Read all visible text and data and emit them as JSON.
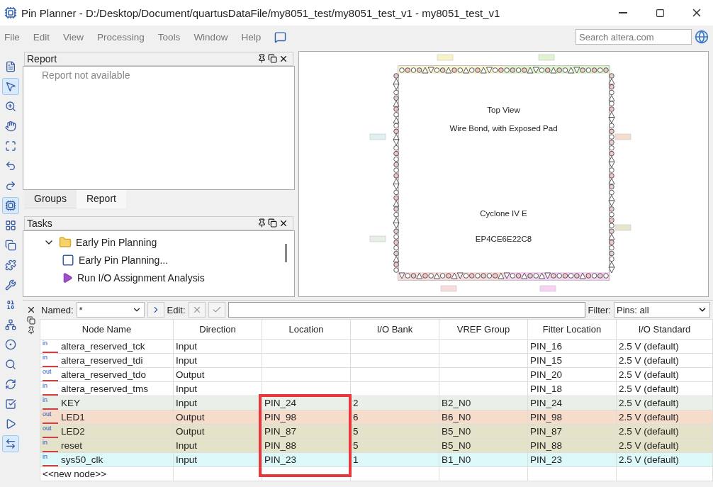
{
  "window": {
    "title": "Pin Planner - D:/Desktop/Document/quartusDataFile/my8051_test/my8051_test_v1 - my8051_test_v1"
  },
  "menu": [
    "File",
    "Edit",
    "View",
    "Processing",
    "Tools",
    "Window",
    "Help"
  ],
  "search": {
    "placeholder": "Search altera.com"
  },
  "toolbar": [
    {
      "kind": "report",
      "selected": false
    },
    {
      "kind": "pointer",
      "selected": true
    },
    {
      "kind": "zoom",
      "selected": false
    },
    {
      "kind": "hand",
      "selected": false
    },
    {
      "kind": "fit",
      "selected": false
    },
    {
      "kind": "undo",
      "selected": false
    },
    {
      "kind": "redo",
      "selected": false
    },
    {
      "kind": "chip",
      "selected": true
    },
    {
      "kind": "vref",
      "selected": false
    },
    {
      "kind": "edge",
      "selected": false
    },
    {
      "kind": "grid",
      "selected": false
    },
    {
      "kind": "probe",
      "selected": false
    },
    {
      "kind": "pins",
      "selected": false
    },
    {
      "kind": "tree",
      "selected": false
    },
    {
      "kind": "dots",
      "selected": false
    },
    {
      "kind": "find",
      "selected": false
    },
    {
      "kind": "refresh",
      "selected": false
    },
    {
      "kind": "check",
      "selected": false
    },
    {
      "kind": "io",
      "selected": false
    },
    {
      "kind": "swap",
      "selected": true
    }
  ],
  "report": {
    "title": "Report",
    "message": "Report not available"
  },
  "panel_tabs": [
    {
      "label": "Groups",
      "selected": false
    },
    {
      "label": "Report",
      "selected": true
    }
  ],
  "tasks": {
    "title": "Tasks",
    "items": [
      {
        "kind": "folder",
        "label": "Early Pin Planning",
        "expanded": true,
        "children": [
          {
            "kind": "window",
            "label": "Early Pin Planning..."
          },
          {
            "kind": "run",
            "label": "Run I/O Assignment Analysis"
          }
        ]
      }
    ]
  },
  "chip_view": {
    "texts": [
      "Top View",
      "Wire Bond, with Exposed Pad",
      "Cyclone IV E",
      "EP4CE6E22C8"
    ]
  },
  "filter_bar": {
    "named_label": "Named:",
    "named_value": "*",
    "edit_label": "Edit:",
    "filter_label": "Filter:",
    "filter_value": "Pins: all"
  },
  "table": {
    "columns": [
      "Node Name",
      "Direction",
      "Location",
      "I/O Bank",
      "VREF Group",
      "Fitter Location",
      "I/O Standard"
    ],
    "rows": [
      {
        "io": "in",
        "cells": [
          "altera_reserved_tck",
          "Input",
          "",
          "",
          "",
          "PIN_16",
          "2.5 V (default)"
        ],
        "marked": false
      },
      {
        "io": "in",
        "cells": [
          "altera_reserved_tdi",
          "Input",
          "",
          "",
          "",
          "PIN_15",
          "2.5 V (default)"
        ],
        "marked": false
      },
      {
        "io": "out",
        "cells": [
          "altera_reserved_tdo",
          "Output",
          "",
          "",
          "",
          "PIN_20",
          "2.5 V (default)"
        ],
        "marked": false
      },
      {
        "io": "in",
        "cells": [
          "altera_reserved_tms",
          "Input",
          "",
          "",
          "",
          "PIN_18",
          "2.5 V (default)"
        ],
        "marked": false
      },
      {
        "io": "in",
        "cells": [
          "KEY",
          "Input",
          "PIN_24",
          "2",
          "B2_N0",
          "PIN_24",
          "2.5 V (default)"
        ],
        "color": "#e9f0e8",
        "marked": true
      },
      {
        "io": "out",
        "cells": [
          "LED1",
          "Output",
          "PIN_98",
          "6",
          "B6_N0",
          "PIN_98",
          "2.5 V (default)"
        ],
        "color": "#f5dccb",
        "marked": true
      },
      {
        "io": "out",
        "cells": [
          "LED2",
          "Output",
          "PIN_87",
          "5",
          "B5_N0",
          "PIN_87",
          "2.5 V (default)"
        ],
        "color": "#e4e3c9",
        "marked": true
      },
      {
        "io": "in",
        "cells": [
          "reset",
          "Input",
          "PIN_88",
          "5",
          "B5_N0",
          "PIN_88",
          "2.5 V (default)"
        ],
        "color": "#e4e3c9",
        "marked": true
      },
      {
        "io": "in",
        "cells": [
          "sys50_clk",
          "Input",
          "PIN_23",
          "1",
          "B1_N0",
          "PIN_23",
          "2.5 V (default)"
        ],
        "color": "#dcf8f8",
        "marked": true
      }
    ],
    "new_row": "<<new node>>"
  }
}
